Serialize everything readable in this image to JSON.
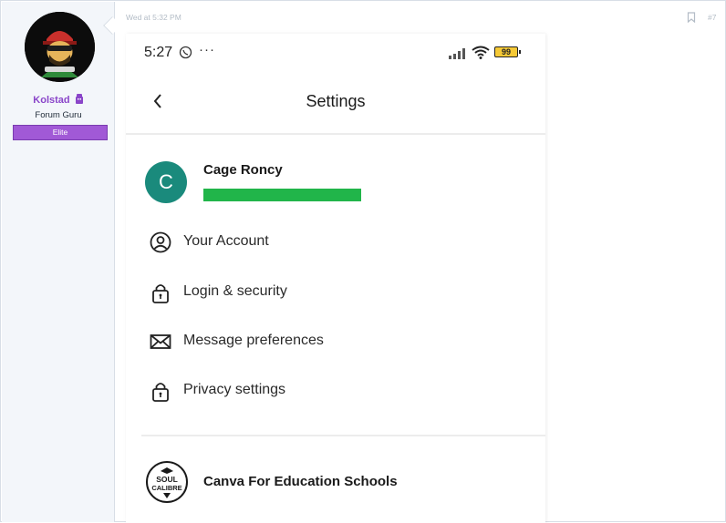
{
  "user": {
    "name": "Kolstad",
    "title": "Forum Guru",
    "banner": "Elite"
  },
  "post": {
    "time": "Wed at 5:32 PM",
    "number": "#7"
  },
  "phone": {
    "status_time": "5:27",
    "status_dots": "···",
    "battery": "99",
    "title": "Settings",
    "profile_initial": "C",
    "profile_name": "Cage Roncy",
    "menu": [
      {
        "label": "Your Account",
        "icon": "user-circle-icon"
      },
      {
        "label": "Login & security",
        "icon": "lock-icon"
      },
      {
        "label": "Message preferences",
        "icon": "envelope-icon"
      },
      {
        "label": "Privacy settings",
        "icon": "lock-icon"
      }
    ],
    "org_name": "Canva For Education Schools",
    "org_logo_text": "SOUL CALIBRE"
  },
  "colors": {
    "username": "#8a45c9",
    "banner": "#a159d6",
    "profile_circle": "#1a8a7c",
    "redaction": "#21b54a"
  }
}
